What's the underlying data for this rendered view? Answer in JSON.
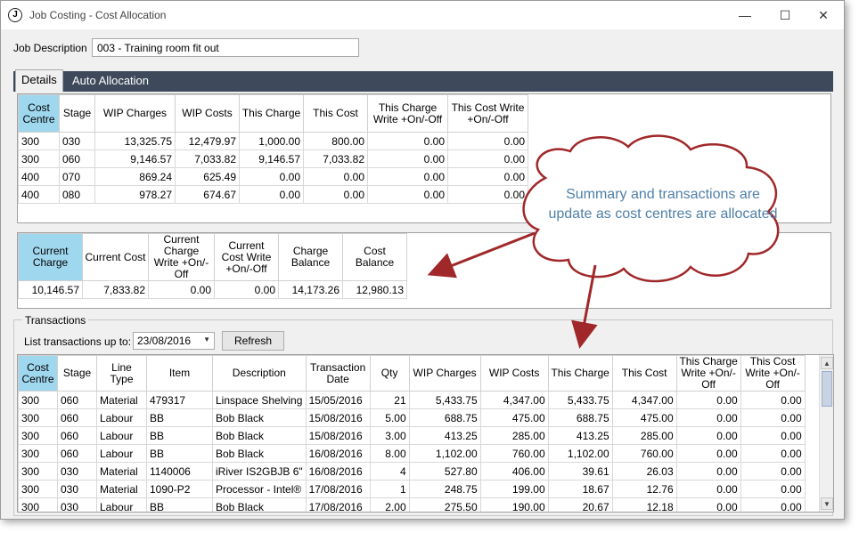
{
  "window": {
    "title": "Job Costing - Cost Allocation",
    "icon_letter": "J"
  },
  "job": {
    "label": "Job Description",
    "value": "003 - Training room fit out"
  },
  "tabs": [
    {
      "label": "Details"
    },
    {
      "label": "Auto Allocation"
    }
  ],
  "allocation_grid": {
    "headers": [
      "Cost Centre",
      "Stage",
      "WIP Charges",
      "WIP Costs",
      "This Charge",
      "This Cost",
      "This Charge Write +On/-Off",
      "This Cost Write +On/-Off"
    ],
    "rows": [
      [
        "300",
        "030",
        "13,325.75",
        "12,479.97",
        "1,000.00",
        "800.00",
        "0.00",
        "0.00"
      ],
      [
        "300",
        "060",
        "9,146.57",
        "7,033.82",
        "9,146.57",
        "7,033.82",
        "0.00",
        "0.00"
      ],
      [
        "400",
        "070",
        "869.24",
        "625.49",
        "0.00",
        "0.00",
        "0.00",
        "0.00"
      ],
      [
        "400",
        "080",
        "978.27",
        "674.67",
        "0.00",
        "0.00",
        "0.00",
        "0.00"
      ]
    ]
  },
  "summary_grid": {
    "headers": [
      "Current Charge",
      "Current Cost",
      "Current Charge Write +On/-Off",
      "Current Cost Write +On/-Off",
      "Charge Balance",
      "Cost Balance"
    ],
    "rows": [
      [
        "10,146.57",
        "7,833.82",
        "0.00",
        "0.00",
        "14,173.26",
        "12,980.13"
      ]
    ]
  },
  "transactions": {
    "group_label": "Transactions",
    "list_label": "List transactions up to:",
    "date_value": "23/08/2016",
    "refresh_label": "Refresh",
    "headers": [
      "Cost Centre",
      "Stage",
      "Line Type",
      "Item",
      "Description",
      "Transaction Date",
      "Qty",
      "WIP Charges",
      "WIP Costs",
      "This Charge",
      "This Cost",
      "This Charge Write +On/-Off",
      "This Cost Write +On/-Off"
    ],
    "rows": [
      [
        "300",
        "060",
        "Material",
        "479317",
        "Linspace Shelving",
        "15/05/2016",
        "21",
        "5,433.75",
        "4,347.00",
        "5,433.75",
        "4,347.00",
        "0.00",
        "0.00"
      ],
      [
        "300",
        "060",
        "Labour",
        "BB",
        "Bob Black",
        "15/08/2016",
        "5.00",
        "688.75",
        "475.00",
        "688.75",
        "475.00",
        "0.00",
        "0.00"
      ],
      [
        "300",
        "060",
        "Labour",
        "BB",
        "Bob Black",
        "15/08/2016",
        "3.00",
        "413.25",
        "285.00",
        "413.25",
        "285.00",
        "0.00",
        "0.00"
      ],
      [
        "300",
        "060",
        "Labour",
        "BB",
        "Bob Black",
        "16/08/2016",
        "8.00",
        "1,102.00",
        "760.00",
        "1,102.00",
        "760.00",
        "0.00",
        "0.00"
      ],
      [
        "300",
        "030",
        "Material",
        "1140006",
        "iRiver IS2GBJB 6\"",
        "16/08/2016",
        "4",
        "527.80",
        "406.00",
        "39.61",
        "26.03",
        "0.00",
        "0.00"
      ],
      [
        "300",
        "030",
        "Material",
        "1090-P2",
        "Processor - Intel®",
        "17/08/2016",
        "1",
        "248.75",
        "199.00",
        "18.67",
        "12.76",
        "0.00",
        "0.00"
      ],
      [
        "300",
        "030",
        "Labour",
        "BB",
        "Bob Black",
        "17/08/2016",
        "2.00",
        "275.50",
        "190.00",
        "20.67",
        "12.18",
        "0.00",
        "0.00"
      ]
    ]
  },
  "callout": {
    "text": "Summary and transactions are update as cost centres are allocated",
    "fill": "#ffffff",
    "stroke": "#a0282a"
  }
}
